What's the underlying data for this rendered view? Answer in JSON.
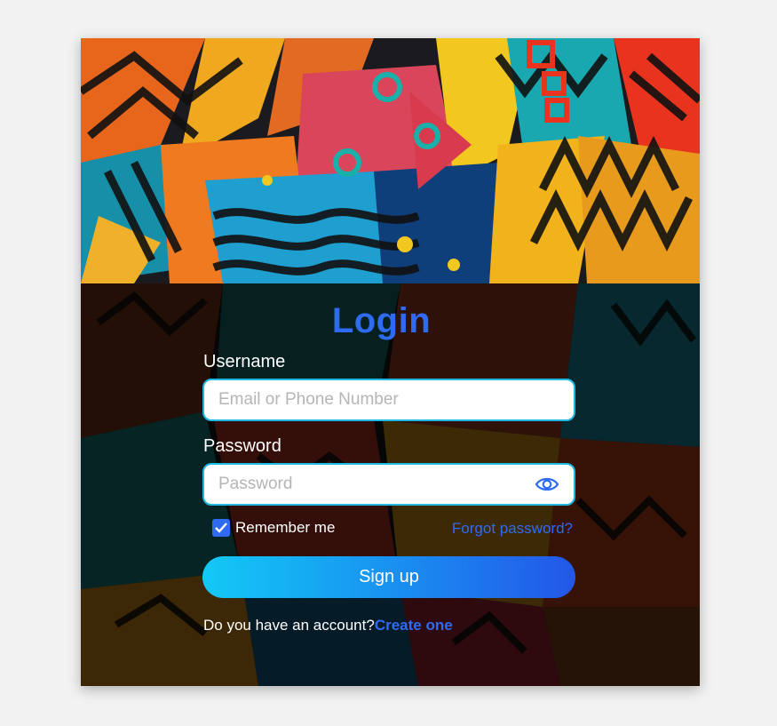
{
  "login": {
    "title": "Login",
    "username": {
      "label": "Username",
      "placeholder": "Email or Phone Number",
      "value": ""
    },
    "password": {
      "label": "Password",
      "placeholder": "Password",
      "value": "",
      "toggle_icon": "eye-icon"
    },
    "remember": {
      "label": "Remember me",
      "checked": true
    },
    "forgot_label": "Forgot password?",
    "signup_label": "Sign up",
    "account_prompt": "Do you have an account?",
    "create_label": "Create one"
  },
  "colors": {
    "accent": "#2f6bf2",
    "field_border": "#1fb8e0",
    "button_start": "#13c9f5",
    "button_end": "#2456e8"
  }
}
